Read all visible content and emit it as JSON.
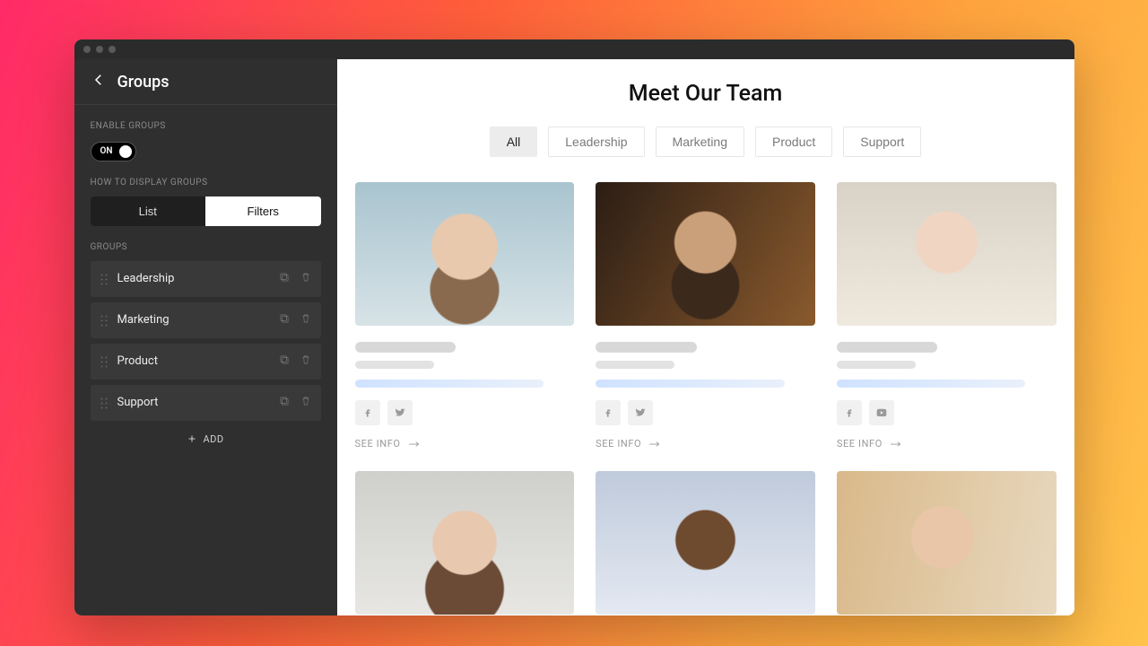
{
  "sidebar": {
    "title": "Groups",
    "enable_groups_label": "ENABLE GROUPS",
    "toggle_state": "ON",
    "display_label": "HOW TO DISPLAY GROUPS",
    "seg_list": "List",
    "seg_filters": "Filters",
    "seg_active": "Filters",
    "groups_label": "GROUPS",
    "items": [
      {
        "label": "Leadership"
      },
      {
        "label": "Marketing"
      },
      {
        "label": "Product"
      },
      {
        "label": "Support"
      }
    ],
    "add_label": "ADD"
  },
  "preview": {
    "title": "Meet Our Team",
    "filters": [
      "All",
      "Leadership",
      "Marketing",
      "Product",
      "Support"
    ],
    "filter_active": "All",
    "see_info": "SEE INFO",
    "cards": [
      {
        "socials": [
          "facebook",
          "twitter"
        ]
      },
      {
        "socials": [
          "facebook",
          "twitter"
        ]
      },
      {
        "socials": [
          "facebook",
          "youtube"
        ]
      },
      {
        "socials": []
      },
      {
        "socials": []
      },
      {
        "socials": []
      }
    ]
  }
}
